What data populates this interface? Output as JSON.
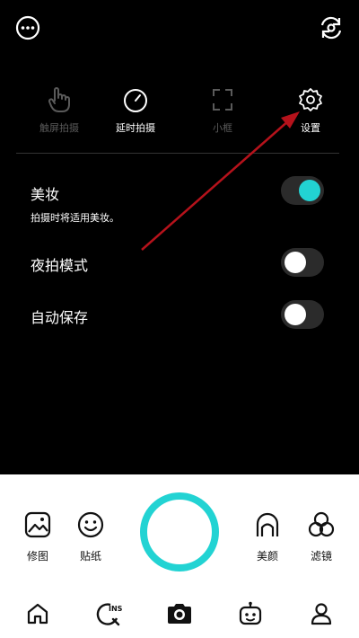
{
  "top": {
    "more_icon": "more-icon",
    "switch_camera_icon": "switch-camera-icon"
  },
  "quick_options": [
    {
      "label": "触屏拍摄",
      "icon": "touch-hand-icon",
      "enabled": false
    },
    {
      "label": "延时拍摄",
      "icon": "timer-icon",
      "enabled": true
    },
    {
      "label": "小框",
      "icon": "frame-corners-icon",
      "enabled": false
    },
    {
      "label": "设置",
      "icon": "gear-icon",
      "enabled": true
    }
  ],
  "settings": [
    {
      "title": "美妆",
      "desc": "拍摄时将适用美妆。",
      "on": true
    },
    {
      "title": "夜拍模式",
      "desc": "",
      "on": false
    },
    {
      "title": "自动保存",
      "desc": "",
      "on": false
    }
  ],
  "tools": [
    {
      "label": "修图",
      "icon": "edit-image-icon"
    },
    {
      "label": "贴纸",
      "icon": "smiley-sticker-icon"
    },
    {
      "label": "美颜",
      "icon": "face-beauty-icon"
    },
    {
      "label": "滤镜",
      "icon": "filter-circles-icon"
    }
  ],
  "nav": [
    {
      "icon": "home-icon"
    },
    {
      "icon": "ins-search-icon",
      "text": "INS"
    },
    {
      "icon": "camera-icon"
    },
    {
      "icon": "robot-icon"
    },
    {
      "icon": "profile-icon"
    }
  ],
  "colors": {
    "accent": "#22d3d3",
    "arrow": "#b5121b",
    "background": "#000000"
  }
}
